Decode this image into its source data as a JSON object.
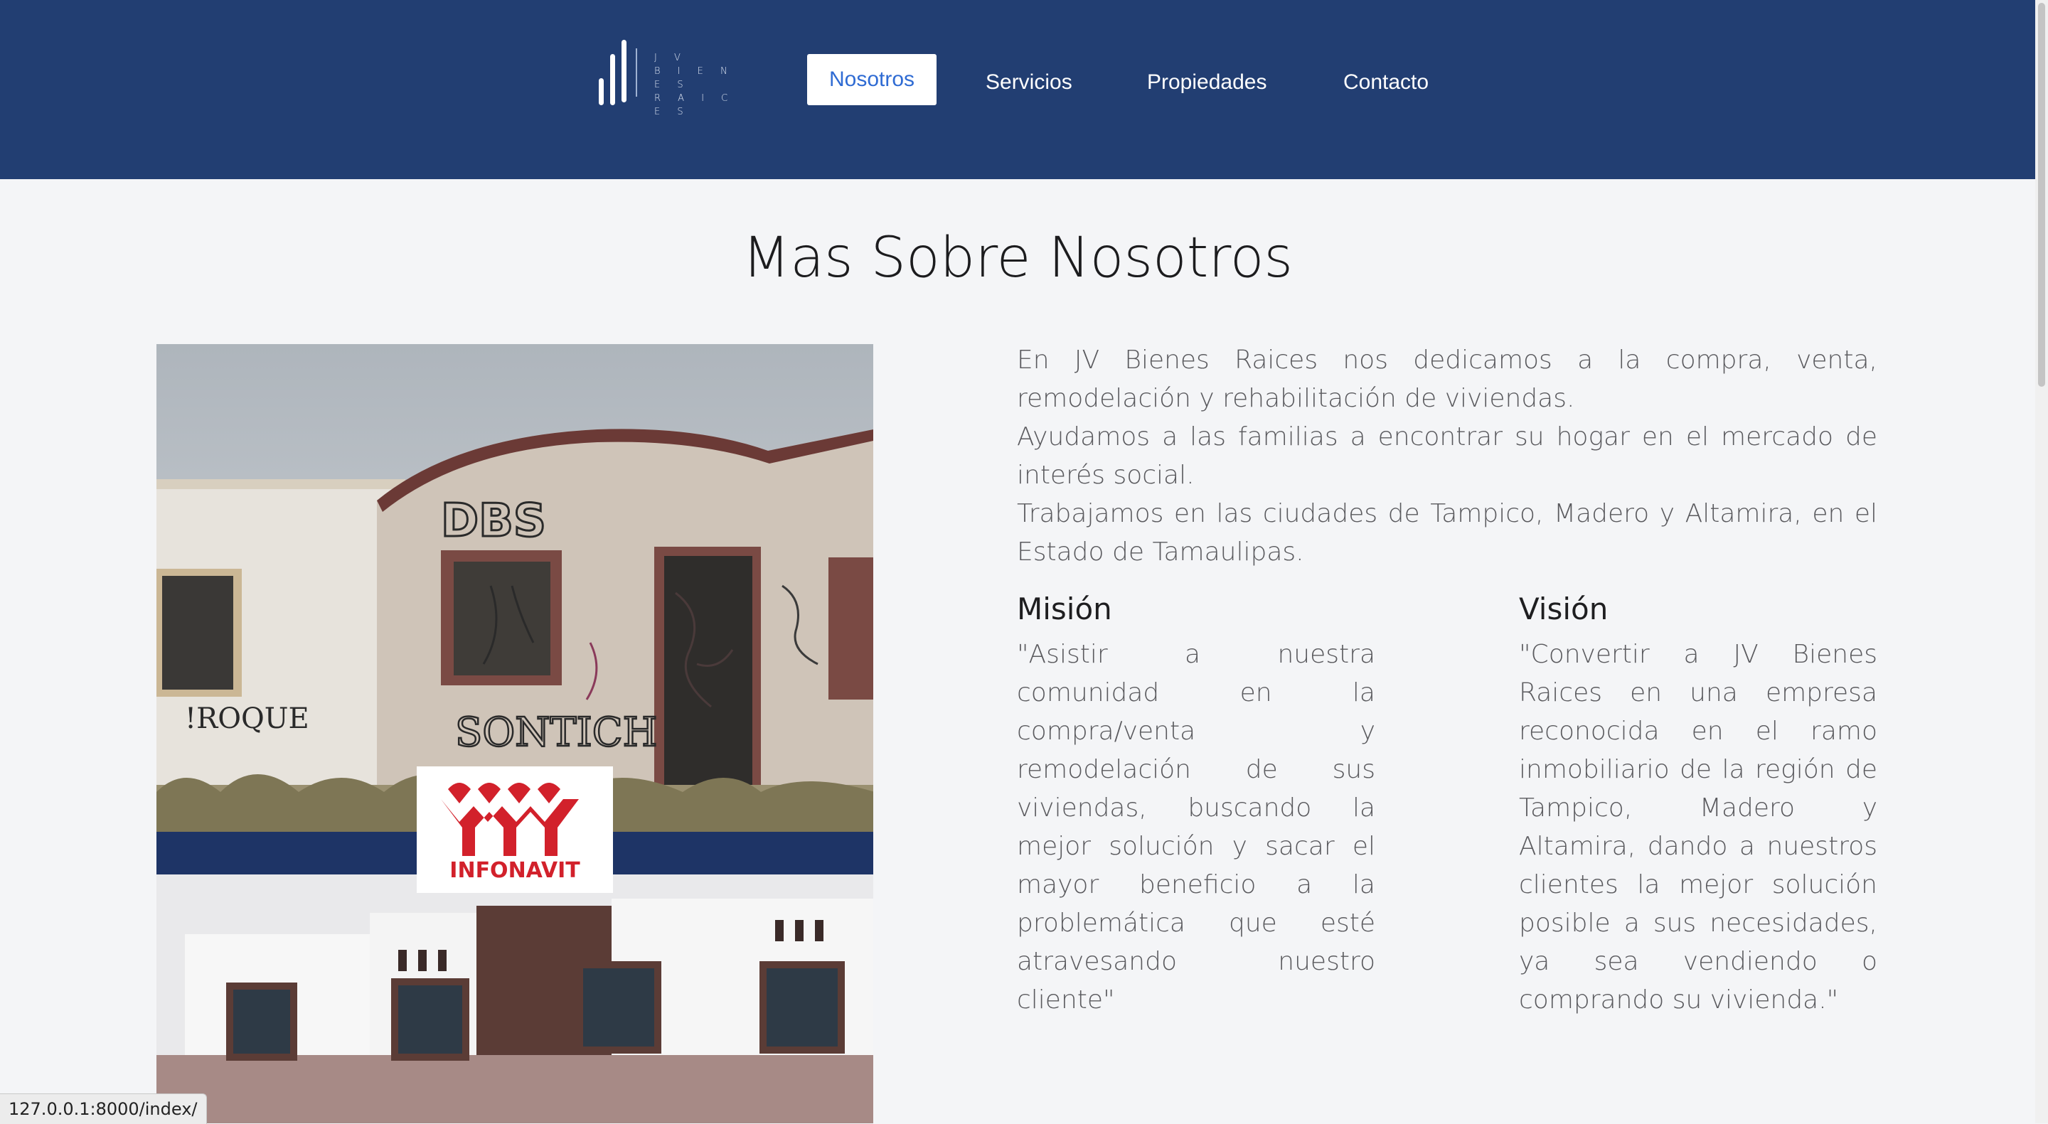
{
  "header": {
    "logo": {
      "line1": "J V",
      "line2": "B I E N E S",
      "line3": "R A I C E S"
    },
    "nav": [
      {
        "label": "Nosotros",
        "active": true
      },
      {
        "label": "Servicios",
        "active": false
      },
      {
        "label": "Propiedades",
        "active": false
      },
      {
        "label": "Contacto",
        "active": false
      }
    ]
  },
  "main": {
    "title": "Mas Sobre Nosotros",
    "intro": [
      "En JV Bienes Raices nos dedicamos a la compra, venta, remodelación y rehabilitación de viviendas.",
      "Ayudamos a las familias a encontrar su hogar en el mercado de interés social.",
      "Trabajamos en las ciudades de Tampico, Madero y Altamira, en el Estado de Tamaulipas."
    ],
    "mision": {
      "title": "Misión",
      "text": "\"Asistir a nuestra comunidad en la compra/venta y remodelación de sus viviendas, buscando la mejor solución y sacar el mayor beneficio a la problemática que esté atravesando nuestro cliente\""
    },
    "vision": {
      "title": "Visión",
      "text": "\"Convertir a JV Bienes Raices en una empresa reconocida en el ramo inmobiliario de la región de Tampico, Madero y Altamira, dando a nuestros clientes la mejor solución posible a sus necesidades, ya sea vendiendo o comprando su vivienda.\""
    },
    "image": {
      "badge_text": "INFONAVIT",
      "graffiti": [
        "DBS",
        "!ROQUE",
        "SONTICH"
      ]
    }
  },
  "status_url": "127.0.0.1:8000/index/",
  "colors": {
    "header_bg": "#223e72",
    "active_nav_text": "#2f6bd3",
    "page_bg": "#f4f5f7",
    "infonavit_red": "#d2212b"
  }
}
